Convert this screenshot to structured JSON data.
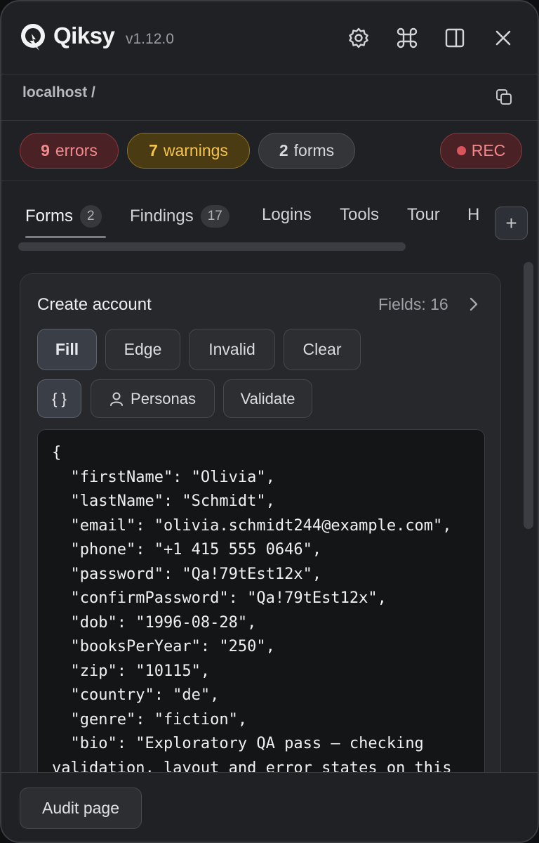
{
  "header": {
    "brand": "Qiksy",
    "version": "v1.12.0",
    "icons": [
      "gear-icon",
      "command-icon",
      "sidebar-panel-icon",
      "close-icon"
    ]
  },
  "breadcrumb": {
    "text": "localhost /"
  },
  "status": {
    "errors": {
      "count": "9",
      "label": "errors"
    },
    "warnings": {
      "count": "7",
      "label": "warnings"
    },
    "forms": {
      "count": "2",
      "label": "forms"
    },
    "rec": "REC"
  },
  "tabs": [
    {
      "label": "Forms",
      "count": "2"
    },
    {
      "label": "Findings",
      "count": "17"
    },
    {
      "label": "Logins"
    },
    {
      "label": "Tools"
    },
    {
      "label": "Tour"
    },
    {
      "label": "H"
    }
  ],
  "add_tab_label": "+",
  "card": {
    "title": "Create account",
    "fields": "Fields: 16",
    "buttons": {
      "fill": "Fill",
      "edge": "Edge",
      "invalid": "Invalid",
      "clear": "Clear",
      "json": "{ }",
      "personas": "Personas",
      "validate": "Validate"
    },
    "code_lines": [
      "{",
      "  \"firstName\": \"Olivia\",",
      "  \"lastName\": \"Schmidt\",",
      "  \"email\": \"olivia.schmidt244@example.com\",",
      "  \"phone\": \"+1 415 555 0646\",",
      "  \"password\": \"Qa!79tEst12x\",",
      "  \"confirmPassword\": \"Qa!79tEst12x\",",
      "  \"dob\": \"1996-08-28\",",
      "  \"booksPerYear\": \"250\",",
      "  \"zip\": \"10115\",",
      "  \"country\": \"de\",",
      "  \"genre\": \"fiction\",",
      "  \"bio\": \"Exploratory QA pass — checking",
      "validation, layout and error states on this"
    ]
  },
  "footer": {
    "audit": "Audit page"
  },
  "colors": {
    "errors": "#f28b8f",
    "warnings": "#f5c44e",
    "rec_dot": "#d9545b"
  }
}
